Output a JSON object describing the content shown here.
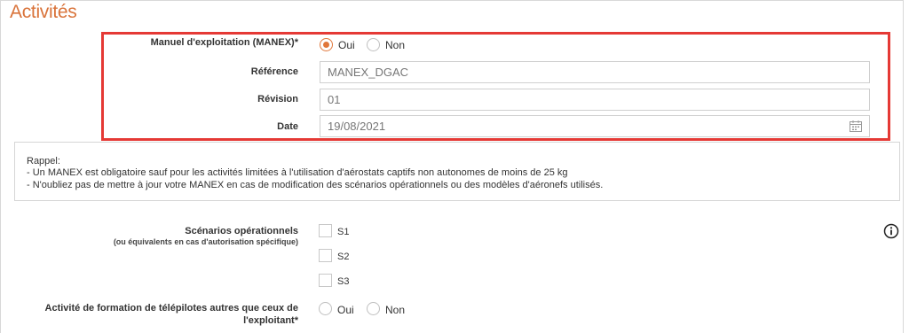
{
  "section": {
    "title": "Activités"
  },
  "manex": {
    "label": "Manuel d'exploitation (MANEX)*",
    "options": {
      "oui": "Oui",
      "non": "Non"
    },
    "selected": "oui"
  },
  "reference": {
    "label": "Référence",
    "value": "MANEX_DGAC"
  },
  "revision": {
    "label": "Révision",
    "value": "01"
  },
  "date": {
    "label": "Date",
    "value": "19/08/2021",
    "icon": "calendar-icon"
  },
  "rappel": {
    "lines": [
      "Rappel:",
      "- Un MANEX est obligatoire sauf pour les activités limitées à l'utilisation d'aérostats captifs non autonomes de moins de 25 kg",
      "- N'oubliez pas de mettre à jour votre MANEX en cas de modification des scénarios opérationnels ou des modèles d'aéronefs utilisés."
    ]
  },
  "scenarios": {
    "label": "Scénarios opérationnels",
    "sublabel": "(ou équivalents en cas d'autorisation spécifique)",
    "options": [
      "S1",
      "S2",
      "S3"
    ],
    "info_icon": "info-icon"
  },
  "formation": {
    "label_line1": "Activité de formation de télépilotes autres que ceux de",
    "label_line2": "l'exploitant*",
    "options": {
      "oui": "Oui",
      "non": "Non"
    }
  },
  "colors": {
    "accent": "#d9733a",
    "highlight": "#e53935"
  }
}
